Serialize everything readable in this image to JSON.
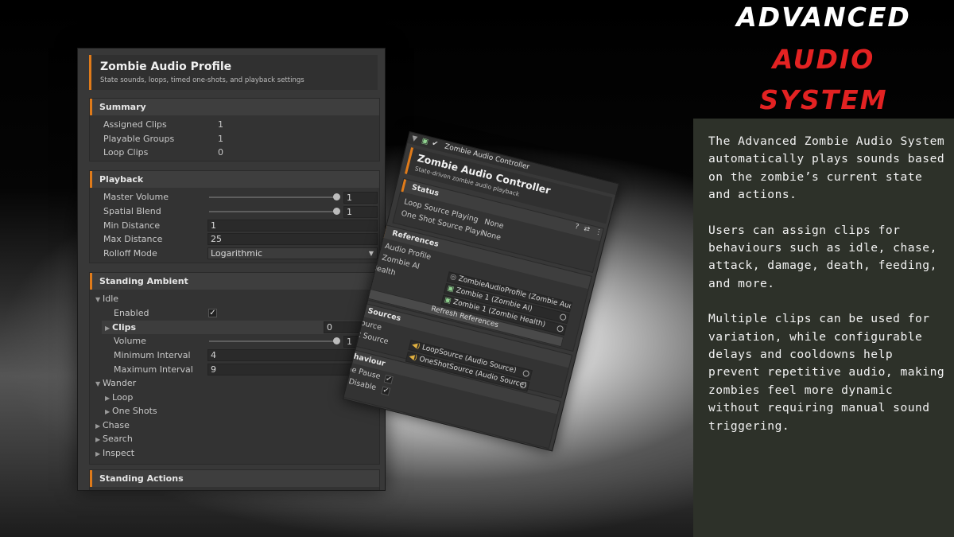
{
  "hero": {
    "line1": "ADVANCED",
    "line2": "AUDIO",
    "line3": "SYSTEM"
  },
  "info": {
    "p1": "The Advanced Zombie Audio System automatically plays sounds based on the zombie’s current state and actions.",
    "p2": "Users can assign clips for behaviours such as idle, chase, attack, damage, death, feeding, and more.",
    "p3": "Multiple clips can be used for variation, while configurable delays and cooldowns help prevent repetitive audio, making zombies feel more dynamic without requiring manual sound triggering."
  },
  "inspector": {
    "title": "Zombie Audio Profile",
    "subtitle": "State sounds, loops, timed one-shots, and playback settings",
    "summary": {
      "header": "Summary",
      "assigned_label": "Assigned Clips",
      "assigned_value": "1",
      "groups_label": "Playable Groups",
      "groups_value": "1",
      "loop_label": "Loop Clips",
      "loop_value": "0"
    },
    "playback": {
      "header": "Playback",
      "master_label": "Master Volume",
      "master_value": "1",
      "spatial_label": "Spatial Blend",
      "spatial_value": "1",
      "min_label": "Min Distance",
      "min_value": "1",
      "max_label": "Max Distance",
      "max_value": "25",
      "rolloff_label": "Rolloff Mode",
      "rolloff_value": "Logarithmic"
    },
    "ambient": {
      "header": "Standing Ambient",
      "idle": "Idle",
      "enabled_label": "Enabled",
      "clips_label": "Clips",
      "clips_value": "0",
      "volume_label": "Volume",
      "volume_value": "1",
      "min_int_label": "Minimum Interval",
      "min_int_value": "4",
      "max_int_label": "Maximum Interval",
      "max_int_value": "9",
      "wander": "Wander",
      "loop": "Loop",
      "one_shots": "One Shots",
      "chase": "Chase",
      "search": "Search",
      "inspect": "Inspect"
    },
    "actions_header": "Standing Actions"
  },
  "controller": {
    "tab": "Zombie Audio Controller",
    "title": "Zombie Audio Controller",
    "subtitle": "State-driven zombie audio playback",
    "status_header": "Status",
    "loop_playing_label": "Loop Source Playing",
    "loop_playing_value": "None",
    "oneshot_playing_label": "One Shot Source Playi",
    "oneshot_playing_value": "None",
    "refs_header": "References",
    "audio_profile_label": "Audio Profile",
    "audio_profile_value": "ZombieAudioProfile (Zombie Aud",
    "zombie_ai_label": "Zombie AI",
    "zombie_ai_value": "Zombie 1 (Zombie AI)",
    "health_label": "Health",
    "health_value": "Zombie 1 (Zombie Health)",
    "refresh_button": "Refresh References",
    "sources_header": "o Sources",
    "loop_src_label": "Source",
    "loop_src_value": "LoopSource (Audio Source)",
    "oneshot_src_label": "ot Source",
    "oneshot_src_value": "OneShotSource (Audio Source)",
    "behaviour_header": "ehaviour",
    "pause_label": "me Pause",
    "disable_label": "n Disable"
  }
}
